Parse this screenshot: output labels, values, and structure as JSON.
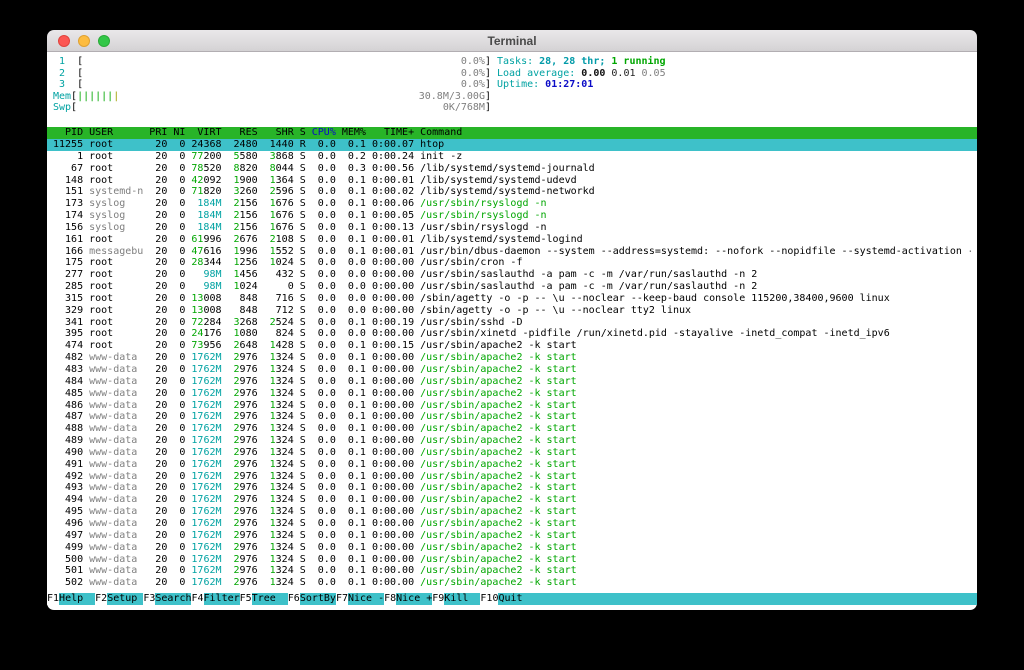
{
  "window": {
    "title": "Terminal"
  },
  "meters": {
    "lbracket": "[",
    "rbracket": "]",
    "cpus": [
      {
        "label": "1",
        "value": "0.0%"
      },
      {
        "label": "2",
        "value": "0.0%"
      },
      {
        "label": "3",
        "value": "0.0%"
      }
    ],
    "mem": {
      "label": "Mem",
      "used_bar": "||||||",
      "cache_bar": "|",
      "value": "30.8M/3.00G"
    },
    "swp": {
      "label": "Swp",
      "value": "0K/768M"
    }
  },
  "stats": {
    "tasks_label": "Tasks:",
    "tasks_value": "28, 28 thr;",
    "tasks_running": "1 running",
    "load_label": "Load average:",
    "load1": "0.00",
    "load5": "0.01",
    "load15": "0.05",
    "uptime_label": "Uptime:",
    "uptime_value": "01:27:01"
  },
  "table": {
    "sort_column": "cpu",
    "headers": {
      "pid": "PID",
      "user": "USER",
      "pri": "PRI",
      "ni": "NI",
      "virt": "VIRT",
      "res": "RES",
      "shr": "SHR",
      "s": "S",
      "cpu": "CPU%",
      "mem": "MEM%",
      "time": "TIME+",
      "cmd": "Command"
    }
  },
  "processes": [
    {
      "pid": "11255",
      "user": "root",
      "pri": "20",
      "ni": "0",
      "virt": "24368",
      "res": "2480",
      "shr": "1440",
      "s": "R",
      "cpu": "0.0",
      "mem": "0.1",
      "time": "0:00.07",
      "cmd": "htop",
      "sel": true
    },
    {
      "pid": "1",
      "user": "root",
      "pri": "20",
      "ni": "0",
      "virt": "77200",
      "res": "5580",
      "shr": "3868",
      "s": "S",
      "cpu": "0.0",
      "mem": "0.2",
      "time": "0:00.24",
      "cmd": "init -z"
    },
    {
      "pid": "67",
      "user": "root",
      "pri": "20",
      "ni": "0",
      "virt": "78520",
      "res": "8820",
      "shr": "8044",
      "s": "S",
      "cpu": "0.0",
      "mem": "0.3",
      "time": "0:00.56",
      "cmd": "/lib/systemd/systemd-journald"
    },
    {
      "pid": "148",
      "user": "root",
      "pri": "20",
      "ni": "0",
      "virt": "42092",
      "res": "1900",
      "shr": "1364",
      "s": "S",
      "cpu": "0.0",
      "mem": "0.1",
      "time": "0:00.01",
      "cmd": "/lib/systemd/systemd-udevd"
    },
    {
      "pid": "151",
      "user": "systemd-n",
      "pri": "20",
      "ni": "0",
      "virt": "71820",
      "res": "3260",
      "shr": "2596",
      "s": "S",
      "cpu": "0.0",
      "mem": "0.1",
      "time": "0:00.02",
      "cmd": "/lib/systemd/systemd-networkd",
      "dim": true
    },
    {
      "pid": "173",
      "user": "syslog",
      "pri": "20",
      "ni": "0",
      "virt": "184M",
      "res": "2156",
      "shr": "1676",
      "s": "S",
      "cpu": "0.0",
      "mem": "0.1",
      "time": "0:00.06",
      "cmd": "/usr/sbin/rsyslogd -n",
      "dim": true,
      "thr": true
    },
    {
      "pid": "174",
      "user": "syslog",
      "pri": "20",
      "ni": "0",
      "virt": "184M",
      "res": "2156",
      "shr": "1676",
      "s": "S",
      "cpu": "0.0",
      "mem": "0.1",
      "time": "0:00.05",
      "cmd": "/usr/sbin/rsyslogd -n",
      "dim": true,
      "thr": true
    },
    {
      "pid": "156",
      "user": "syslog",
      "pri": "20",
      "ni": "0",
      "virt": "184M",
      "res": "2156",
      "shr": "1676",
      "s": "S",
      "cpu": "0.0",
      "mem": "0.1",
      "time": "0:00.13",
      "cmd": "/usr/sbin/rsyslogd -n",
      "dim": true
    },
    {
      "pid": "161",
      "user": "root",
      "pri": "20",
      "ni": "0",
      "virt": "61996",
      "res": "2676",
      "shr": "2108",
      "s": "S",
      "cpu": "0.0",
      "mem": "0.1",
      "time": "0:00.01",
      "cmd": "/lib/systemd/systemd-logind"
    },
    {
      "pid": "166",
      "user": "messagebu",
      "pri": "20",
      "ni": "0",
      "virt": "47616",
      "res": "1996",
      "shr": "1552",
      "s": "S",
      "cpu": "0.0",
      "mem": "0.1",
      "time": "0:00.01",
      "cmd": "/usr/bin/dbus-daemon --system --address=systemd: --nofork --nopidfile --systemd-activation --sysl",
      "dim": true
    },
    {
      "pid": "175",
      "user": "root",
      "pri": "20",
      "ni": "0",
      "virt": "28344",
      "res": "1256",
      "shr": "1024",
      "s": "S",
      "cpu": "0.0",
      "mem": "0.0",
      "time": "0:00.00",
      "cmd": "/usr/sbin/cron -f"
    },
    {
      "pid": "277",
      "user": "root",
      "pri": "20",
      "ni": "0",
      "virt": "98M",
      "res": "1456",
      "shr": "432",
      "s": "S",
      "cpu": "0.0",
      "mem": "0.0",
      "time": "0:00.00",
      "cmd": "/usr/sbin/saslauthd -a pam -c -m /var/run/saslauthd -n 2"
    },
    {
      "pid": "285",
      "user": "root",
      "pri": "20",
      "ni": "0",
      "virt": "98M",
      "res": "1024",
      "shr": "0",
      "s": "S",
      "cpu": "0.0",
      "mem": "0.0",
      "time": "0:00.00",
      "cmd": "/usr/sbin/saslauthd -a pam -c -m /var/run/saslauthd -n 2"
    },
    {
      "pid": "315",
      "user": "root",
      "pri": "20",
      "ni": "0",
      "virt": "13008",
      "res": "848",
      "shr": "716",
      "s": "S",
      "cpu": "0.0",
      "mem": "0.0",
      "time": "0:00.00",
      "cmd": "/sbin/agetty -o -p -- \\u --noclear --keep-baud console 115200,38400,9600 linux"
    },
    {
      "pid": "329",
      "user": "root",
      "pri": "20",
      "ni": "0",
      "virt": "13008",
      "res": "848",
      "shr": "712",
      "s": "S",
      "cpu": "0.0",
      "mem": "0.0",
      "time": "0:00.00",
      "cmd": "/sbin/agetty -o -p -- \\u --noclear tty2 linux"
    },
    {
      "pid": "341",
      "user": "root",
      "pri": "20",
      "ni": "0",
      "virt": "72284",
      "res": "3268",
      "shr": "2524",
      "s": "S",
      "cpu": "0.0",
      "mem": "0.1",
      "time": "0:00.19",
      "cmd": "/usr/sbin/sshd -D"
    },
    {
      "pid": "395",
      "user": "root",
      "pri": "20",
      "ni": "0",
      "virt": "24176",
      "res": "1080",
      "shr": "824",
      "s": "S",
      "cpu": "0.0",
      "mem": "0.0",
      "time": "0:00.00",
      "cmd": "/usr/sbin/xinetd -pidfile /run/xinetd.pid -stayalive -inetd_compat -inetd_ipv6"
    },
    {
      "pid": "474",
      "user": "root",
      "pri": "20",
      "ni": "0",
      "virt": "73956",
      "res": "2648",
      "shr": "1428",
      "s": "S",
      "cpu": "0.0",
      "mem": "0.1",
      "time": "0:00.15",
      "cmd": "/usr/sbin/apache2 -k start"
    },
    {
      "pid": "482",
      "user": "www-data",
      "pri": "20",
      "ni": "0",
      "virt": "1762M",
      "res": "2976",
      "shr": "1324",
      "s": "S",
      "cpu": "0.0",
      "mem": "0.1",
      "time": "0:00.00",
      "cmd": "/usr/sbin/apache2 -k start",
      "dim": true,
      "thr": true
    },
    {
      "pid": "483",
      "user": "www-data",
      "pri": "20",
      "ni": "0",
      "virt": "1762M",
      "res": "2976",
      "shr": "1324",
      "s": "S",
      "cpu": "0.0",
      "mem": "0.1",
      "time": "0:00.00",
      "cmd": "/usr/sbin/apache2 -k start",
      "dim": true,
      "thr": true
    },
    {
      "pid": "484",
      "user": "www-data",
      "pri": "20",
      "ni": "0",
      "virt": "1762M",
      "res": "2976",
      "shr": "1324",
      "s": "S",
      "cpu": "0.0",
      "mem": "0.1",
      "time": "0:00.00",
      "cmd": "/usr/sbin/apache2 -k start",
      "dim": true,
      "thr": true
    },
    {
      "pid": "485",
      "user": "www-data",
      "pri": "20",
      "ni": "0",
      "virt": "1762M",
      "res": "2976",
      "shr": "1324",
      "s": "S",
      "cpu": "0.0",
      "mem": "0.1",
      "time": "0:00.00",
      "cmd": "/usr/sbin/apache2 -k start",
      "dim": true,
      "thr": true
    },
    {
      "pid": "486",
      "user": "www-data",
      "pri": "20",
      "ni": "0",
      "virt": "1762M",
      "res": "2976",
      "shr": "1324",
      "s": "S",
      "cpu": "0.0",
      "mem": "0.1",
      "time": "0:00.00",
      "cmd": "/usr/sbin/apache2 -k start",
      "dim": true,
      "thr": true
    },
    {
      "pid": "487",
      "user": "www-data",
      "pri": "20",
      "ni": "0",
      "virt": "1762M",
      "res": "2976",
      "shr": "1324",
      "s": "S",
      "cpu": "0.0",
      "mem": "0.1",
      "time": "0:00.00",
      "cmd": "/usr/sbin/apache2 -k start",
      "dim": true,
      "thr": true
    },
    {
      "pid": "488",
      "user": "www-data",
      "pri": "20",
      "ni": "0",
      "virt": "1762M",
      "res": "2976",
      "shr": "1324",
      "s": "S",
      "cpu": "0.0",
      "mem": "0.1",
      "time": "0:00.00",
      "cmd": "/usr/sbin/apache2 -k start",
      "dim": true,
      "thr": true
    },
    {
      "pid": "489",
      "user": "www-data",
      "pri": "20",
      "ni": "0",
      "virt": "1762M",
      "res": "2976",
      "shr": "1324",
      "s": "S",
      "cpu": "0.0",
      "mem": "0.1",
      "time": "0:00.00",
      "cmd": "/usr/sbin/apache2 -k start",
      "dim": true,
      "thr": true
    },
    {
      "pid": "490",
      "user": "www-data",
      "pri": "20",
      "ni": "0",
      "virt": "1762M",
      "res": "2976",
      "shr": "1324",
      "s": "S",
      "cpu": "0.0",
      "mem": "0.1",
      "time": "0:00.00",
      "cmd": "/usr/sbin/apache2 -k start",
      "dim": true,
      "thr": true
    },
    {
      "pid": "491",
      "user": "www-data",
      "pri": "20",
      "ni": "0",
      "virt": "1762M",
      "res": "2976",
      "shr": "1324",
      "s": "S",
      "cpu": "0.0",
      "mem": "0.1",
      "time": "0:00.00",
      "cmd": "/usr/sbin/apache2 -k start",
      "dim": true,
      "thr": true
    },
    {
      "pid": "492",
      "user": "www-data",
      "pri": "20",
      "ni": "0",
      "virt": "1762M",
      "res": "2976",
      "shr": "1324",
      "s": "S",
      "cpu": "0.0",
      "mem": "0.1",
      "time": "0:00.00",
      "cmd": "/usr/sbin/apache2 -k start",
      "dim": true,
      "thr": true
    },
    {
      "pid": "493",
      "user": "www-data",
      "pri": "20",
      "ni": "0",
      "virt": "1762M",
      "res": "2976",
      "shr": "1324",
      "s": "S",
      "cpu": "0.0",
      "mem": "0.1",
      "time": "0:00.00",
      "cmd": "/usr/sbin/apache2 -k start",
      "dim": true,
      "thr": true
    },
    {
      "pid": "494",
      "user": "www-data",
      "pri": "20",
      "ni": "0",
      "virt": "1762M",
      "res": "2976",
      "shr": "1324",
      "s": "S",
      "cpu": "0.0",
      "mem": "0.1",
      "time": "0:00.00",
      "cmd": "/usr/sbin/apache2 -k start",
      "dim": true,
      "thr": true
    },
    {
      "pid": "495",
      "user": "www-data",
      "pri": "20",
      "ni": "0",
      "virt": "1762M",
      "res": "2976",
      "shr": "1324",
      "s": "S",
      "cpu": "0.0",
      "mem": "0.1",
      "time": "0:00.00",
      "cmd": "/usr/sbin/apache2 -k start",
      "dim": true,
      "thr": true
    },
    {
      "pid": "496",
      "user": "www-data",
      "pri": "20",
      "ni": "0",
      "virt": "1762M",
      "res": "2976",
      "shr": "1324",
      "s": "S",
      "cpu": "0.0",
      "mem": "0.1",
      "time": "0:00.00",
      "cmd": "/usr/sbin/apache2 -k start",
      "dim": true,
      "thr": true
    },
    {
      "pid": "497",
      "user": "www-data",
      "pri": "20",
      "ni": "0",
      "virt": "1762M",
      "res": "2976",
      "shr": "1324",
      "s": "S",
      "cpu": "0.0",
      "mem": "0.1",
      "time": "0:00.00",
      "cmd": "/usr/sbin/apache2 -k start",
      "dim": true,
      "thr": true
    },
    {
      "pid": "499",
      "user": "www-data",
      "pri": "20",
      "ni": "0",
      "virt": "1762M",
      "res": "2976",
      "shr": "1324",
      "s": "S",
      "cpu": "0.0",
      "mem": "0.1",
      "time": "0:00.00",
      "cmd": "/usr/sbin/apache2 -k start",
      "dim": true,
      "thr": true
    },
    {
      "pid": "500",
      "user": "www-data",
      "pri": "20",
      "ni": "0",
      "virt": "1762M",
      "res": "2976",
      "shr": "1324",
      "s": "S",
      "cpu": "0.0",
      "mem": "0.1",
      "time": "0:00.00",
      "cmd": "/usr/sbin/apache2 -k start",
      "dim": true,
      "thr": true
    },
    {
      "pid": "501",
      "user": "www-data",
      "pri": "20",
      "ni": "0",
      "virt": "1762M",
      "res": "2976",
      "shr": "1324",
      "s": "S",
      "cpu": "0.0",
      "mem": "0.1",
      "time": "0:00.00",
      "cmd": "/usr/sbin/apache2 -k start",
      "dim": true,
      "thr": true
    },
    {
      "pid": "502",
      "user": "www-data",
      "pri": "20",
      "ni": "0",
      "virt": "1762M",
      "res": "2976",
      "shr": "1324",
      "s": "S",
      "cpu": "0.0",
      "mem": "0.1",
      "time": "0:00.00",
      "cmd": "/usr/sbin/apache2 -k start",
      "dim": true,
      "thr": true
    }
  ],
  "fnbar": {
    "keys": [
      {
        "key": "F1",
        "label": "Help"
      },
      {
        "key": "F2",
        "label": "Setup"
      },
      {
        "key": "F3",
        "label": "Search"
      },
      {
        "key": "F4",
        "label": "Filter"
      },
      {
        "key": "F5",
        "label": "Tree"
      },
      {
        "key": "F6",
        "label": "SortBy"
      },
      {
        "key": "F7",
        "label": "Nice -"
      },
      {
        "key": "F8",
        "label": "Nice +"
      },
      {
        "key": "F9",
        "label": "Kill"
      },
      {
        "key": "F10",
        "label": "Quit"
      }
    ]
  }
}
